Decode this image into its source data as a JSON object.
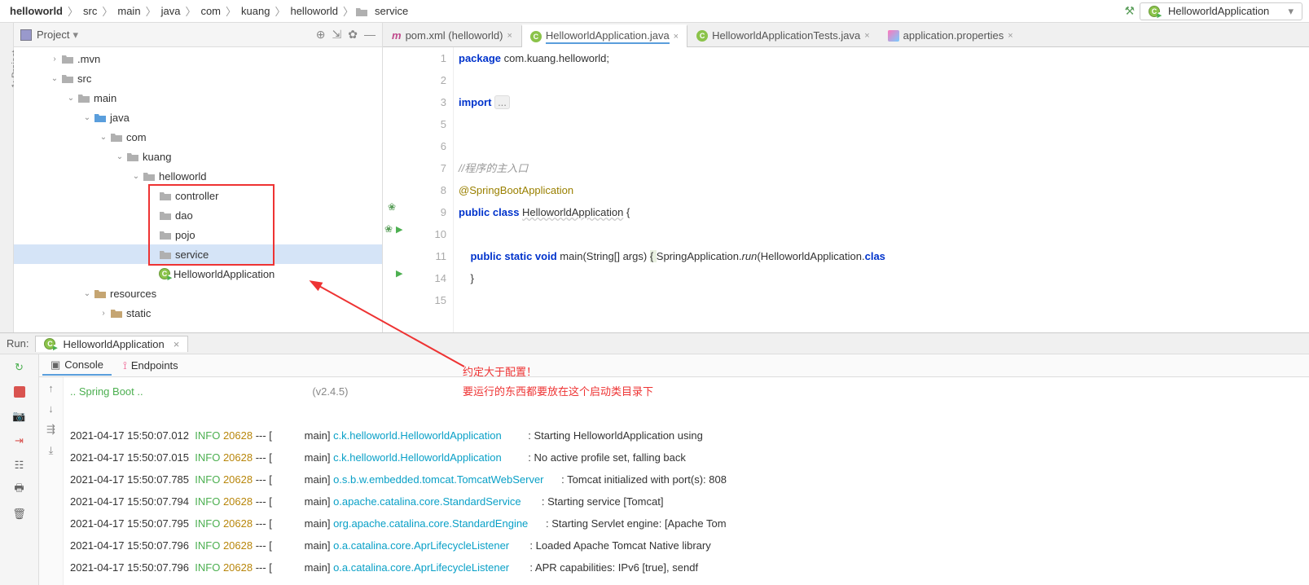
{
  "breadcrumb": [
    "helloworld",
    "src",
    "main",
    "java",
    "com",
    "kuang",
    "helloworld",
    "service"
  ],
  "runConfig": "HelloworldApplication",
  "projectPanel": {
    "title": "Project",
    "sideLabel": "1: Project"
  },
  "tree": {
    "mvn": ".mvn",
    "src": "src",
    "main": "main",
    "java": "java",
    "com": "com",
    "kuang": "kuang",
    "helloworld": "helloworld",
    "controller": "controller",
    "dao": "dao",
    "pojo": "pojo",
    "service": "service",
    "appClass": "HelloworldApplication",
    "resources": "resources",
    "static": "static"
  },
  "tabs": {
    "pom": "pom.xml (helloworld)",
    "app": "HelloworldApplication.java",
    "tests": "HelloworldApplicationTests.java",
    "props": "application.properties"
  },
  "code": {
    "l1_kw": "package",
    "l1_rest": " com.kuang.helloworld;",
    "l3_kw": "import ",
    "l3_fold": "...",
    "l7": "//程序的主入口",
    "l8": "@SpringBootApplication",
    "l9_pub": "public ",
    "l9_class": "class ",
    "l9_name": "HelloworldApplication",
    "l9_brace": " {",
    "l11_1": "    public ",
    "l11_2": "static ",
    "l11_3": "void ",
    "l11_4": "main",
    "l11_5": "(String[] args) ",
    "l11_6": "{ ",
    "l11_7": "SpringApplication.",
    "l11_8": "run",
    "l11_9": "(HelloworldApplication.",
    "l11_10": "clas",
    "l14": "    }"
  },
  "run": {
    "label": "Run:",
    "tabName": "HelloworldApplication",
    "consoleTab": "Console",
    "endpointsTab": "Endpoints",
    "springLine": ".. Spring Boot ..",
    "version": "(v2.4.5)"
  },
  "annotation": {
    "line1": "约定大于配置！",
    "line2": "要运行的东西都要放在这个启动类目录下"
  },
  "log": [
    {
      "ts": "2021-04-17 15:50:07.012",
      "lvl": "INFO",
      "pid": "20628",
      "thread": "main",
      "logger": "c.k.helloworld.HelloworldApplication",
      "msg": "Starting HelloworldApplication using"
    },
    {
      "ts": "2021-04-17 15:50:07.015",
      "lvl": "INFO",
      "pid": "20628",
      "thread": "main",
      "logger": "c.k.helloworld.HelloworldApplication",
      "msg": "No active profile set, falling back"
    },
    {
      "ts": "2021-04-17 15:50:07.785",
      "lvl": "INFO",
      "pid": "20628",
      "thread": "main",
      "logger": "o.s.b.w.embedded.tomcat.TomcatWebServer",
      "msg": "Tomcat initialized with port(s): 808"
    },
    {
      "ts": "2021-04-17 15:50:07.794",
      "lvl": "INFO",
      "pid": "20628",
      "thread": "main",
      "logger": "o.apache.catalina.core.StandardService",
      "msg": "Starting service [Tomcat]"
    },
    {
      "ts": "2021-04-17 15:50:07.795",
      "lvl": "INFO",
      "pid": "20628",
      "thread": "main",
      "logger": "org.apache.catalina.core.StandardEngine",
      "msg": "Starting Servlet engine: [Apache Tom"
    },
    {
      "ts": "2021-04-17 15:50:07.796",
      "lvl": "INFO",
      "pid": "20628",
      "thread": "main",
      "logger": "o.a.catalina.core.AprLifecycleListener",
      "msg": "Loaded Apache Tomcat Native library"
    },
    {
      "ts": "2021-04-17 15:50:07.796",
      "lvl": "INFO",
      "pid": "20628",
      "thread": "main",
      "logger": "o.a.catalina.core.AprLifecycleListener",
      "msg": "APR capabilities: IPv6 [true], sendf"
    }
  ]
}
